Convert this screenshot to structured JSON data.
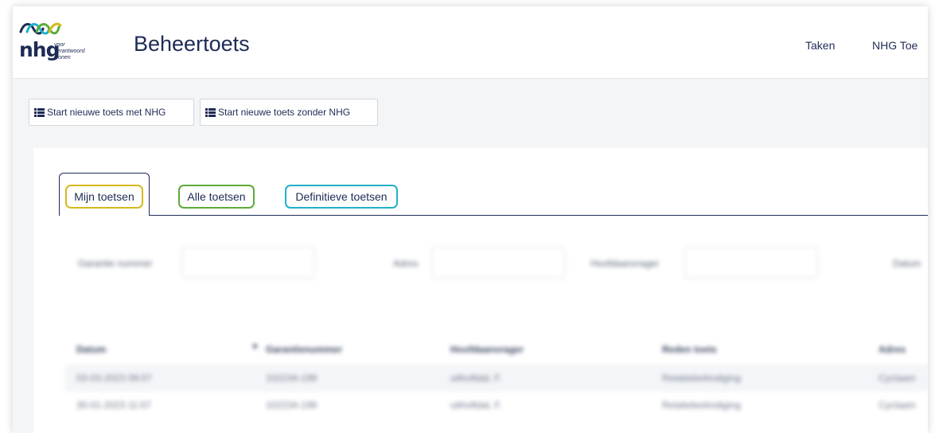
{
  "header": {
    "logo": {
      "word": "nhg",
      "tagline": [
        "voor",
        "verantwoord",
        "wonen"
      ]
    },
    "title": "Beheertoets",
    "nav": [
      {
        "label": "Taken"
      },
      {
        "label": "NHG Toe"
      }
    ]
  },
  "toolbar": {
    "buttons": [
      {
        "label": "Start nieuwe toets met NHG",
        "icon": "list-icon"
      },
      {
        "label": "Start nieuwe toets zonder NHG",
        "icon": "list-icon"
      }
    ]
  },
  "tabs": [
    {
      "label": "Mijn toetsen",
      "active": true,
      "color": "#d6b91c"
    },
    {
      "label": "Alle toetsen",
      "active": false,
      "color": "#5cab3a"
    },
    {
      "label": "Definitieve toetsen",
      "active": false,
      "color": "#1fb1c9"
    }
  ],
  "filters": [
    {
      "label": "Garantie nummer",
      "value": ""
    },
    {
      "label": "Adres",
      "value": ""
    },
    {
      "label": "Hoofdaanvrager",
      "value": ""
    },
    {
      "label": "Datum",
      "value": ""
    }
  ],
  "table": {
    "columns": [
      "Datum",
      "Garantienummer",
      "Hoofdaanvrager",
      "Reden toets",
      "Adres"
    ],
    "sort_icon": "sort-desc-icon",
    "rows": [
      [
        "03-03-2023 09:07",
        "102234-199",
        "uithoftdal, F.",
        "Relatiebeëindiging",
        "Cyclaam"
      ],
      [
        "30-01-2023 11:07",
        "102234-199",
        "uithoftdal, F.",
        "Relatiebeëindiging",
        "Cyclaam"
      ]
    ]
  },
  "colors": {
    "brand_navy": "#1d2b55",
    "logo_blue": "#1fb1c9",
    "logo_green": "#5cab3a",
    "logo_yellow": "#d6b91c"
  }
}
